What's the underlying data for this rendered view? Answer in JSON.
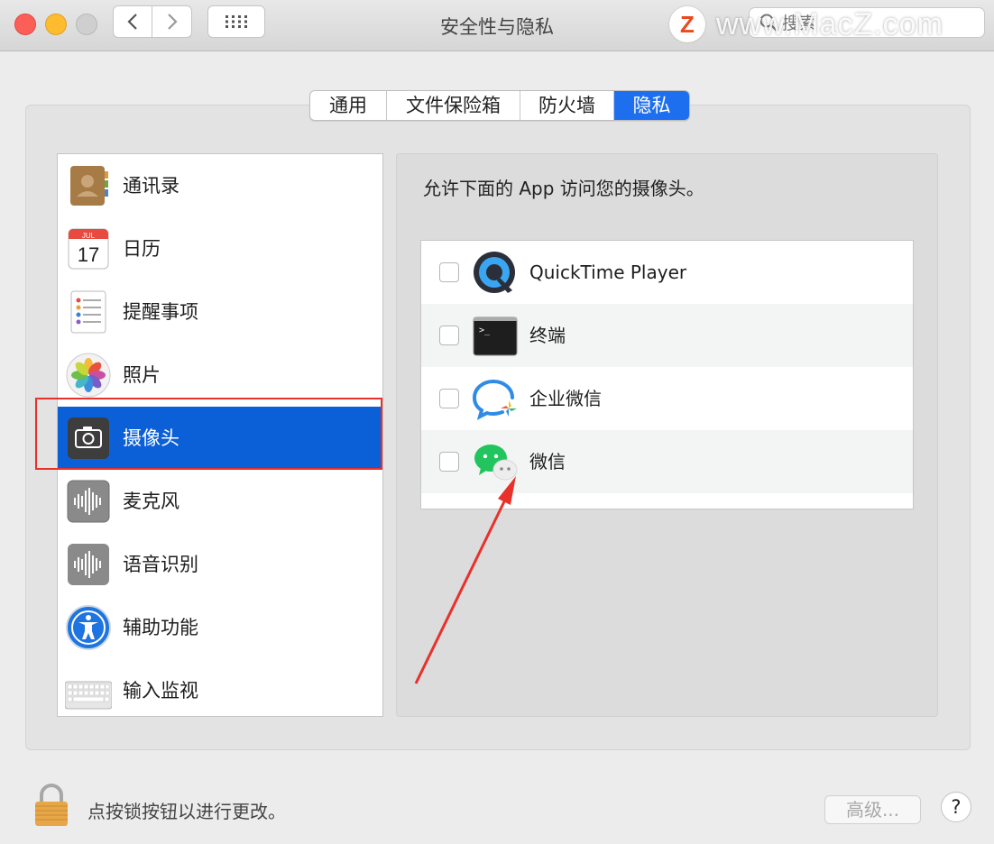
{
  "window": {
    "title": "安全性与隐私"
  },
  "search": {
    "placeholder": "搜索"
  },
  "watermark": {
    "logo": "Z",
    "text": "www.MacZ.com"
  },
  "tabs": [
    {
      "label": "通用"
    },
    {
      "label": "文件保险箱"
    },
    {
      "label": "防火墙"
    },
    {
      "label": "隐私",
      "active": true
    }
  ],
  "sidebar": {
    "items": [
      {
        "label": "通讯录",
        "icon": "contacts-icon"
      },
      {
        "label": "日历",
        "icon": "calendar-icon",
        "icon_month": "JUL",
        "icon_day": "17"
      },
      {
        "label": "提醒事项",
        "icon": "reminders-icon"
      },
      {
        "label": "照片",
        "icon": "photos-icon"
      },
      {
        "label": "摄像头",
        "icon": "camera-icon",
        "selected": true
      },
      {
        "label": "麦克风",
        "icon": "microphone-icon"
      },
      {
        "label": "语音识别",
        "icon": "speech-recognition-icon"
      },
      {
        "label": "辅助功能",
        "icon": "accessibility-icon"
      },
      {
        "label": "输入监视",
        "icon": "keyboard-icon"
      }
    ]
  },
  "camera": {
    "prompt": "允许下面的 App 访问您的摄像头。",
    "apps": [
      {
        "name": "QuickTime Player",
        "checked": false,
        "icon": "quicktime-icon"
      },
      {
        "name": "终端",
        "checked": false,
        "icon": "terminal-icon",
        "icon_text": ">_"
      },
      {
        "name": "企业微信",
        "checked": false,
        "icon": "wecom-icon"
      },
      {
        "name": "微信",
        "checked": false,
        "icon": "wechat-icon"
      }
    ]
  },
  "footer": {
    "lock_text": "点按锁按钮以进行更改。",
    "advanced_label": "高级...",
    "help_label": "?"
  },
  "colors": {
    "accent": "#0b5fd7",
    "tab_active": "#1e6ff0",
    "annotation": "#e8312b"
  }
}
